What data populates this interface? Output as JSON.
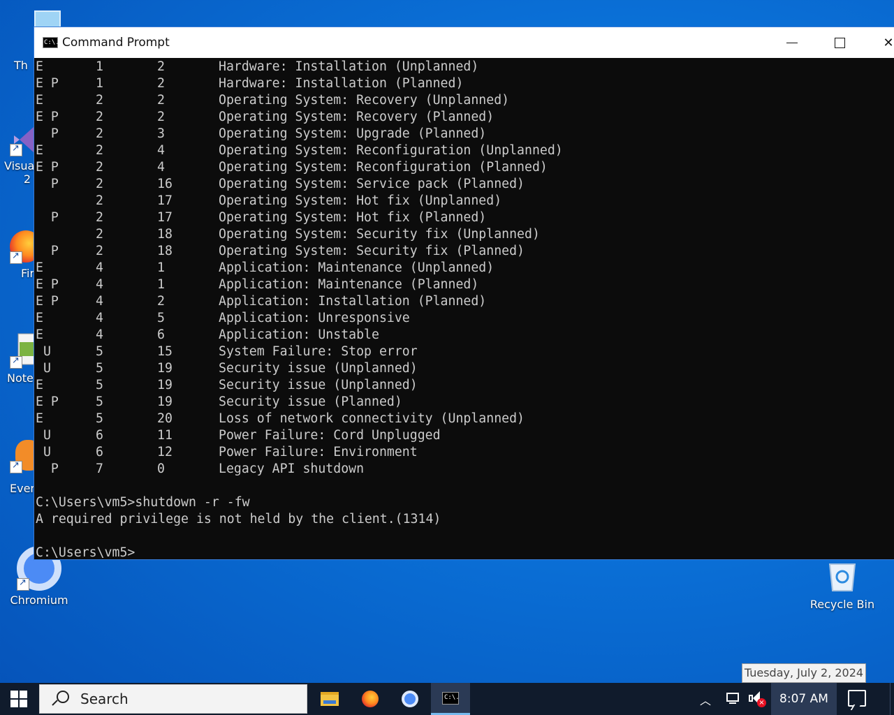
{
  "desktop": {
    "icons": [
      {
        "label": "Th"
      },
      {
        "label": "Visua"
      },
      {
        "label": "Fir"
      },
      {
        "label": "Note"
      },
      {
        "label": "Ever"
      },
      {
        "label": "Chromium"
      },
      {
        "label": "Recycle Bin"
      }
    ],
    "vs_sub": "2"
  },
  "window": {
    "title": "Command Prompt",
    "title_icon": "C:\\."
  },
  "console": {
    "rows": [
      {
        "flag": "E",
        "major": "1",
        "minor": "2",
        "desc": "Hardware: Installation (Unplanned)"
      },
      {
        "flag": "E P",
        "major": "1",
        "minor": "2",
        "desc": "Hardware: Installation (Planned)"
      },
      {
        "flag": "E",
        "major": "2",
        "minor": "2",
        "desc": "Operating System: Recovery (Unplanned)"
      },
      {
        "flag": "E P",
        "major": "2",
        "minor": "2",
        "desc": "Operating System: Recovery (Planned)"
      },
      {
        "flag": "  P",
        "major": "2",
        "minor": "3",
        "desc": "Operating System: Upgrade (Planned)"
      },
      {
        "flag": "E",
        "major": "2",
        "minor": "4",
        "desc": "Operating System: Reconfiguration (Unplanned)"
      },
      {
        "flag": "E P",
        "major": "2",
        "minor": "4",
        "desc": "Operating System: Reconfiguration (Planned)"
      },
      {
        "flag": "  P",
        "major": "2",
        "minor": "16",
        "desc": "Operating System: Service pack (Planned)"
      },
      {
        "flag": "",
        "major": "2",
        "minor": "17",
        "desc": "Operating System: Hot fix (Unplanned)"
      },
      {
        "flag": "  P",
        "major": "2",
        "minor": "17",
        "desc": "Operating System: Hot fix (Planned)"
      },
      {
        "flag": "",
        "major": "2",
        "minor": "18",
        "desc": "Operating System: Security fix (Unplanned)"
      },
      {
        "flag": "  P",
        "major": "2",
        "minor": "18",
        "desc": "Operating System: Security fix (Planned)"
      },
      {
        "flag": "E",
        "major": "4",
        "minor": "1",
        "desc": "Application: Maintenance (Unplanned)"
      },
      {
        "flag": "E P",
        "major": "4",
        "minor": "1",
        "desc": "Application: Maintenance (Planned)"
      },
      {
        "flag": "E P",
        "major": "4",
        "minor": "2",
        "desc": "Application: Installation (Planned)"
      },
      {
        "flag": "E",
        "major": "4",
        "minor": "5",
        "desc": "Application: Unresponsive"
      },
      {
        "flag": "E",
        "major": "4",
        "minor": "6",
        "desc": "Application: Unstable"
      },
      {
        "flag": " U",
        "major": "5",
        "minor": "15",
        "desc": "System Failure: Stop error"
      },
      {
        "flag": " U",
        "major": "5",
        "minor": "19",
        "desc": "Security issue (Unplanned)"
      },
      {
        "flag": "E",
        "major": "5",
        "minor": "19",
        "desc": "Security issue (Unplanned)"
      },
      {
        "flag": "E P",
        "major": "5",
        "minor": "19",
        "desc": "Security issue (Planned)"
      },
      {
        "flag": "E",
        "major": "5",
        "minor": "20",
        "desc": "Loss of network connectivity (Unplanned)"
      },
      {
        "flag": " U",
        "major": "6",
        "minor": "11",
        "desc": "Power Failure: Cord Unplugged"
      },
      {
        "flag": " U",
        "major": "6",
        "minor": "12",
        "desc": "Power Failure: Environment"
      },
      {
        "flag": "  P",
        "major": "7",
        "minor": "0",
        "desc": "Legacy API shutdown"
      }
    ],
    "command_line": "C:\\Users\\vm5>shutdown -r -fw",
    "error_line": "A required privilege is not held by the client.(1314)",
    "prompt_line": "C:\\Users\\vm5>"
  },
  "tooltip": {
    "date": "Tuesday, July 2, 2024"
  },
  "taskbar": {
    "search_label": "Search",
    "clock": "8:07 AM",
    "cmd_icon_text": "C:\\."
  },
  "colors": {
    "console_bg": "#0c0c0c",
    "console_fg": "#cccccc",
    "taskbar_bg": "#101b2c",
    "desktop_blue": "#0a6fd6"
  }
}
